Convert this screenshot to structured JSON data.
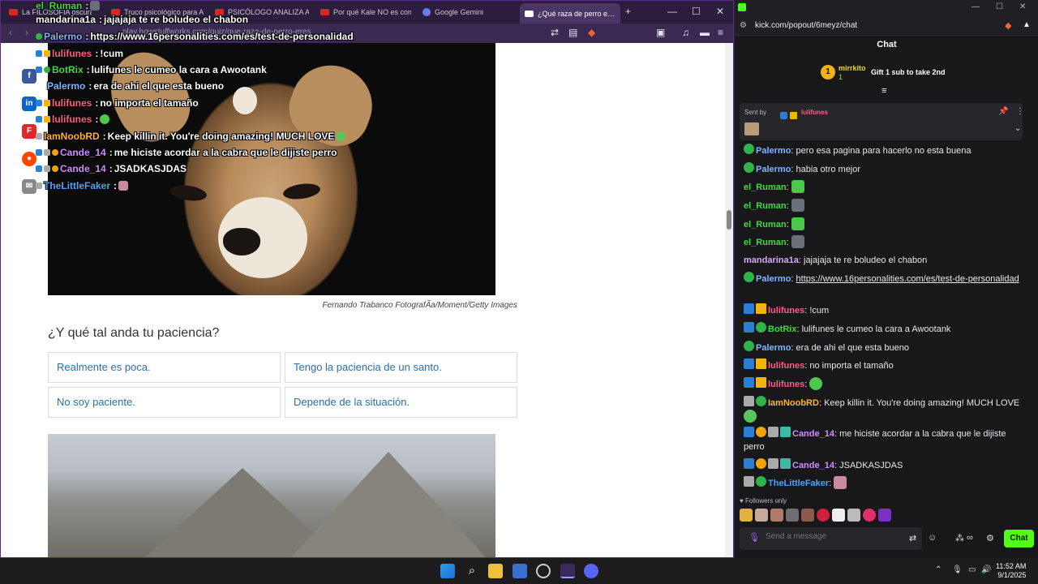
{
  "left_browser": {
    "tabs": [
      {
        "label": "La FILOSOFÍA oscura d…",
        "icon": "youtube-icon"
      },
      {
        "label": "Truco psicológico para An…",
        "icon": "youtube-icon"
      },
      {
        "label": "PSICÓLOGO ANALIZA A T…",
        "icon": "youtube-icon"
      },
      {
        "label": "Por qué Kale NO es como…",
        "icon": "youtube-icon"
      },
      {
        "label": "Google Gemini",
        "icon": "gemini-icon"
      },
      {
        "label": "¿Qué raza de perro e…",
        "icon": "quiz-icon",
        "active": true
      }
    ],
    "new_tab": "+",
    "window_controls": [
      "—",
      "☐",
      "✕"
    ],
    "address_url": "play.howstuffworks.com/quiz/que-raza-de-perro-eres",
    "page": {
      "photo_caption": "Fernando Trabanco FotografÃa/Moment/Getty Images",
      "question": "¿Y qué tal anda tu paciencia?",
      "answers": [
        "Realmente es poca.",
        "Tengo la paciencia de un santo.",
        "No soy paciente.",
        "Depende de la situación."
      ]
    },
    "share_icons": [
      "facebook-icon",
      "linkedin-icon",
      "flipboard-icon",
      "reddit-icon",
      "email-icon"
    ]
  },
  "overlay_chat": [
    {
      "user": "el_Ruman",
      "text": "",
      "color": "#3ddc3d"
    },
    {
      "user": "mandarina1a",
      "text": "jajajaja te re boludeo el chabon",
      "color": "#ffffff"
    },
    {
      "user": "Palermo",
      "text": "https://www.16personalities.com/es/test-de-personalidad",
      "color": "#7fb6ff"
    },
    {
      "user": "lulifunes",
      "text": "!cum",
      "color": "#ff5c8a"
    },
    {
      "user": "BotRix",
      "text": "lulifunes le cumeo la cara a Awootank",
      "color": "#3ddc3d"
    },
    {
      "user": "Palermo",
      "text": "era de ahi el que esta bueno",
      "color": "#7fb6ff"
    },
    {
      "user": "lulifunes",
      "text": "no importa el tamaño",
      "color": "#ff5c8a"
    },
    {
      "user": "lulifunes",
      "text": "",
      "color": "#ff5c8a"
    },
    {
      "user": "IamNoobRD",
      "text": "Keep killin it. You're doing amazing! MUCH LOVE",
      "color": "#ffb13d"
    },
    {
      "user": "Cande_14",
      "text": "me hiciste acordar a la cabra que le dijiste perro",
      "color": "#d08cff"
    },
    {
      "user": "Cande_14",
      "text": "JSADKASJDAS",
      "color": "#d08cff"
    },
    {
      "user": "TheLittleFaker",
      "text": "",
      "color": "#4aa3ff"
    }
  ],
  "kick": {
    "url": "kick.com/popout/6meyz/chat",
    "header": "Chat",
    "leaderboard": {
      "name": "mirrkito",
      "count": "1",
      "gift_text": "Gift 1 sub to take 2nd"
    },
    "pinned": {
      "sent_by_label": "Sent by",
      "user": "lulifunes"
    },
    "messages": [
      {
        "user": "Palermo",
        "text": "pero esa pagina para hacerlo no esta buena",
        "color": "#7fb6ff"
      },
      {
        "user": "Palermo",
        "text": "habia otro mejor",
        "color": "#7fb6ff"
      },
      {
        "user": "el_Ruman",
        "text": "",
        "color": "#3ddc3d"
      },
      {
        "user": "el_Ruman",
        "text": "",
        "color": "#3ddc3d"
      },
      {
        "user": "el_Ruman",
        "text": "",
        "color": "#3ddc3d"
      },
      {
        "user": "el_Ruman",
        "text": "",
        "color": "#3ddc3d"
      },
      {
        "user": "mandarina1a",
        "text": "jajajaja te re boludeo el chabon",
        "color": "#d9a8ff"
      },
      {
        "user": "Palermo",
        "text": "https://www.16personalities.com/es/test-de-personalidad",
        "color": "#7fb6ff"
      },
      {
        "user": "lulifunes",
        "text": "!cum",
        "color": "#ff5c8a"
      },
      {
        "user": "BotRix",
        "text": "lulifunes le cumeo la cara a Awootank",
        "color": "#3ddc3d"
      },
      {
        "user": "Palermo",
        "text": "era de ahi el que esta bueno",
        "color": "#7fb6ff"
      },
      {
        "user": "lulifunes",
        "text": "no importa el tamaño",
        "color": "#ff5c8a"
      },
      {
        "user": "lulifunes",
        "text": "",
        "color": "#ff5c8a"
      },
      {
        "user": "IamNoobRD",
        "text": "Keep killin it. You're doing amazing! MUCH LOVE",
        "color": "#ffb13d"
      },
      {
        "user": "Cande_14",
        "text": "me hiciste acordar a la cabra que le dijiste perro",
        "color": "#d08cff"
      },
      {
        "user": "Cande_14",
        "text": "JSADKASJDAS",
        "color": "#d08cff"
      },
      {
        "user": "TheLittleFaker",
        "text": "",
        "color": "#4aa3ff"
      }
    ],
    "followers_only": "Followers only",
    "send_placeholder": "Send a message",
    "chat_button": "Chat",
    "accent": "#53fc18"
  },
  "taskbar": {
    "time": "11:52 AM",
    "date": "9/1/2025"
  }
}
